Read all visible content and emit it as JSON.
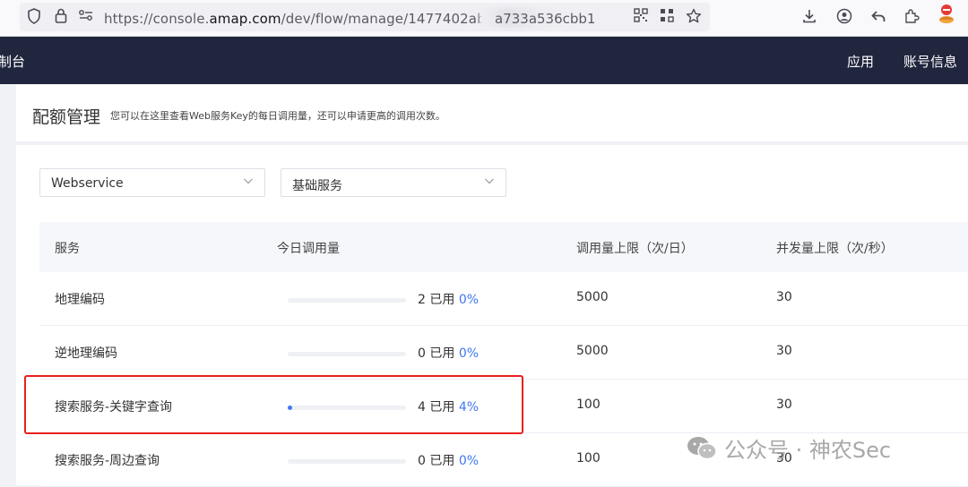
{
  "browser": {
    "url_prefix": "https://console.",
    "url_domain": "amap.com",
    "url_path": "/dev/flow/manage/1477402ab",
    "url_tail": "a733a536cbb1"
  },
  "header": {
    "app_title": "制台",
    "nav": [
      "应用",
      "账号信息"
    ]
  },
  "page": {
    "title": "配额管理",
    "description": "您可以在这里查看Web服务Key的每日调用量，还可以申请更高的调用次数。"
  },
  "filters": {
    "service_type": "Webservice",
    "service_category": "基础服务"
  },
  "table": {
    "columns": [
      "服务",
      "今日调用量",
      "调用量上限（次/日）",
      "并发量上限（次/秒）"
    ],
    "used_label": "已用",
    "rows": [
      {
        "service": "地理编码",
        "used": "2",
        "percent": "0%",
        "fraction": 0.0,
        "daily_limit": "5000",
        "qps_limit": "30"
      },
      {
        "service": "逆地理编码",
        "used": "0",
        "percent": "0%",
        "fraction": 0.0,
        "daily_limit": "5000",
        "qps_limit": "30"
      },
      {
        "service": "搜索服务-关键字查询",
        "used": "4",
        "percent": "4%",
        "fraction": 0.04,
        "daily_limit": "100",
        "qps_limit": "30"
      },
      {
        "service": "搜索服务-周边查询",
        "used": "0",
        "percent": "0%",
        "fraction": 0.0,
        "daily_limit": "100",
        "qps_limit": "30"
      }
    ]
  },
  "watermark": {
    "text": "公众号 · 神农Sec"
  },
  "colors": {
    "accent": "#3e77f2",
    "header_bg": "#20263d",
    "highlight": "#e8201d"
  }
}
